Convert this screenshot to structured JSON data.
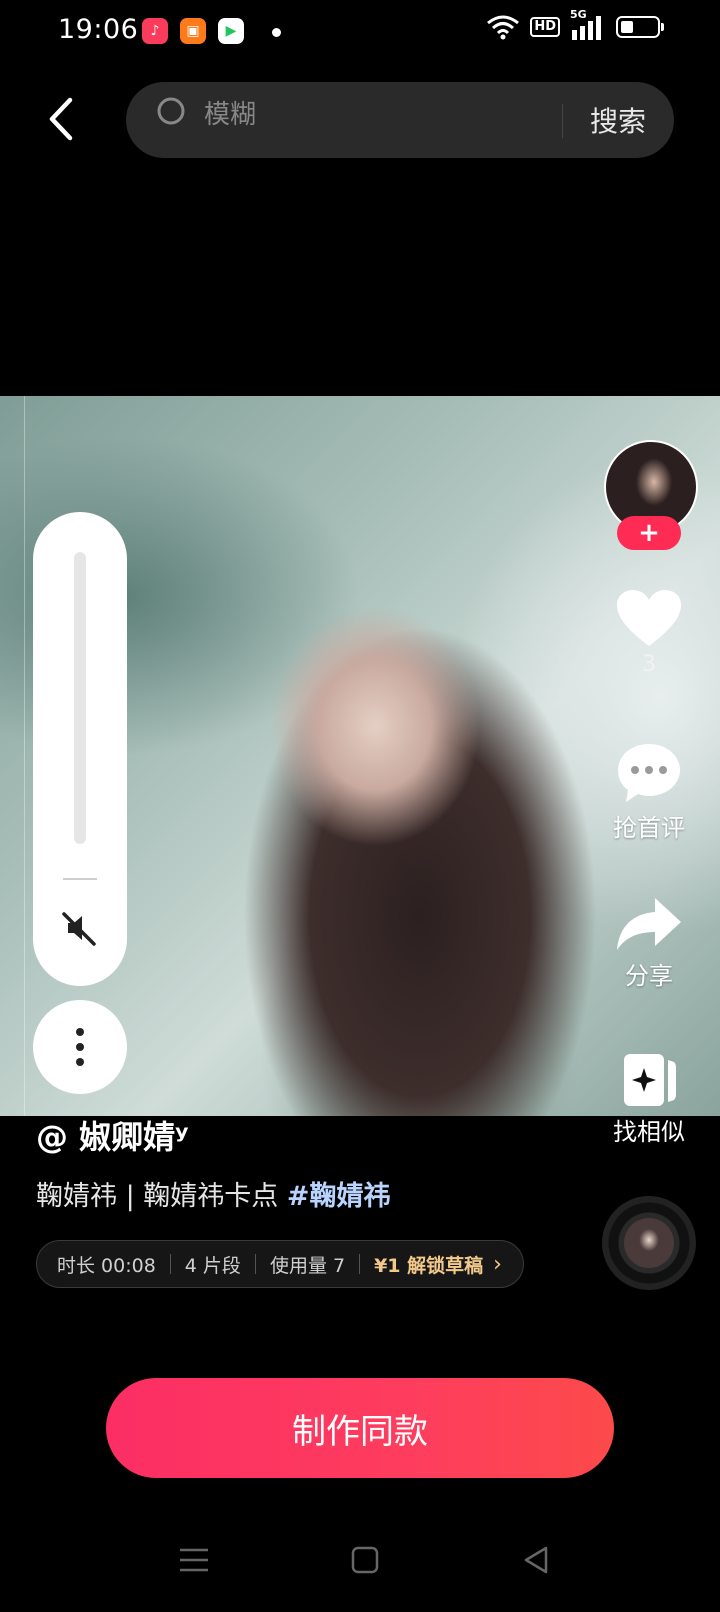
{
  "status": {
    "time": "19:06",
    "apps": [
      "music-icon",
      "shop-icon",
      "video-icon"
    ],
    "hd": "HD",
    "network": "5G"
  },
  "search": {
    "placeholder": "模糊",
    "button_label": "搜索"
  },
  "rail": {
    "like_count": "3",
    "comment_label": "抢首评",
    "share_label": "分享",
    "similar_label": "找相似"
  },
  "post": {
    "author": "@ 婌卿婧ʸ",
    "description": "鞠婧祎 | 鞠婧祎卡点 ",
    "hashtag": "#鞠婧祎"
  },
  "template_info": {
    "duration": "时长 00:08",
    "segments": "4 片段",
    "usage": "使用量 7",
    "unlock": "¥1 解锁草稿"
  },
  "make_button_label": "制作同款",
  "colors": {
    "accent": "#fe2c55",
    "background": "#000000",
    "hashtag": "#b9d4ff",
    "unlock": "#f3c98a"
  }
}
